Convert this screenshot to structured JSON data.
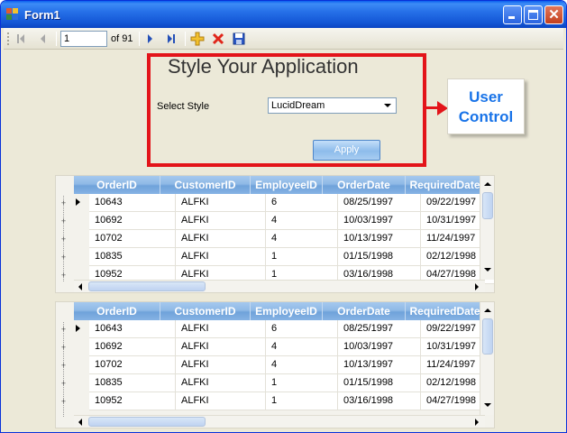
{
  "window": {
    "title": "Form1"
  },
  "navigator": {
    "position": "1",
    "count_label": "of 91"
  },
  "user_control": {
    "title": "Style Your Application",
    "select_label": "Select Style",
    "style_value": "LucidDream",
    "apply_label": "Apply"
  },
  "callout": {
    "line1": "User",
    "line2": "Control"
  },
  "colors": {
    "annotation_red": "#E3141A",
    "callout_blue": "#1873E8",
    "titlebar_blue": "#1457D6"
  },
  "icons": [
    "move-first-icon",
    "move-previous-icon",
    "move-next-icon",
    "move-last-icon",
    "add-new-icon",
    "delete-icon",
    "save-icon"
  ],
  "grid1": {
    "columns": [
      "OrderID",
      "CustomerID",
      "EmployeeID",
      "OrderDate",
      "RequiredDate"
    ],
    "rows": [
      [
        "10643",
        "ALFKI",
        "6",
        "08/25/1997",
        "09/22/1997"
      ],
      [
        "10692",
        "ALFKI",
        "4",
        "10/03/1997",
        "10/31/1997"
      ],
      [
        "10702",
        "ALFKI",
        "4",
        "10/13/1997",
        "11/24/1997"
      ],
      [
        "10835",
        "ALFKI",
        "1",
        "01/15/1998",
        "02/12/1998"
      ],
      [
        "10952",
        "ALFKI",
        "1",
        "03/16/1998",
        "04/27/1998"
      ]
    ]
  },
  "grid2": {
    "columns": [
      "OrderID",
      "CustomerID",
      "EmployeeID",
      "OrderDate",
      "RequiredDate"
    ],
    "rows": [
      [
        "10643",
        "ALFKI",
        "6",
        "08/25/1997",
        "09/22/1997"
      ],
      [
        "10692",
        "ALFKI",
        "4",
        "10/03/1997",
        "10/31/1997"
      ],
      [
        "10702",
        "ALFKI",
        "4",
        "10/13/1997",
        "11/24/1997"
      ],
      [
        "10835",
        "ALFKI",
        "1",
        "01/15/1998",
        "02/12/1998"
      ],
      [
        "10952",
        "ALFKI",
        "1",
        "03/16/1998",
        "04/27/1998"
      ]
    ]
  }
}
